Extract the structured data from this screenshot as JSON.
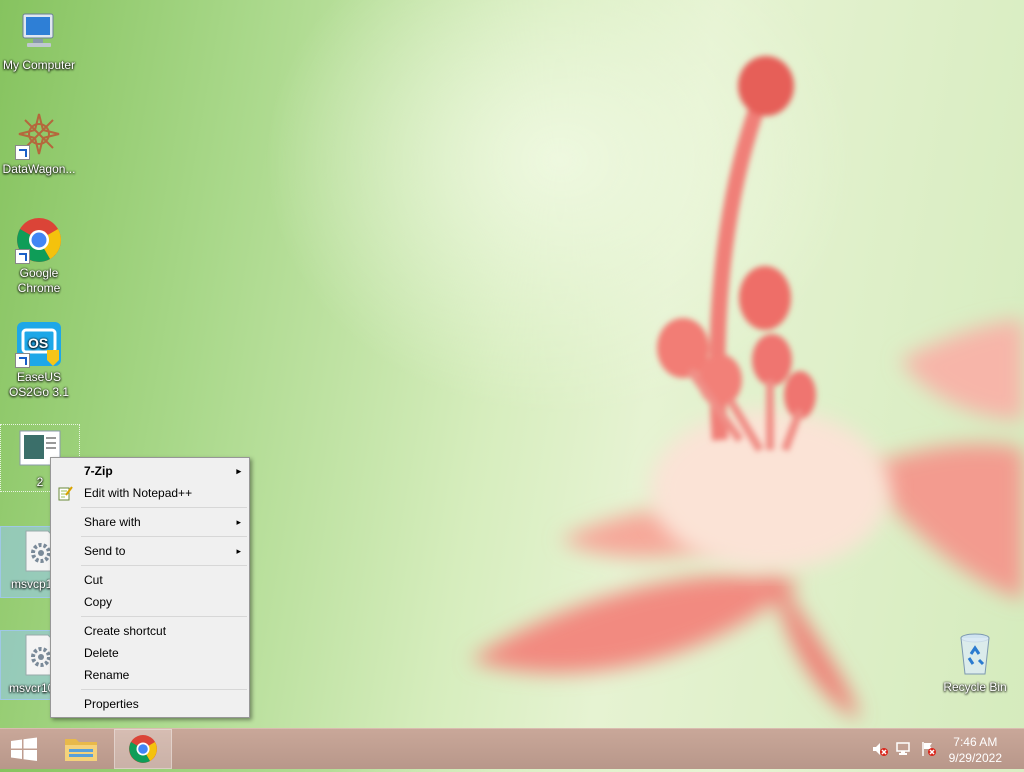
{
  "desktop": {
    "icons": [
      {
        "label": "My Computer"
      },
      {
        "label": "DataWagon..."
      },
      {
        "label": "Google Chrome"
      },
      {
        "label": "EaseUS OS2Go 3.1"
      },
      {
        "label": "2"
      },
      {
        "label": "msvcp10..."
      },
      {
        "label": "msvcr100..."
      },
      {
        "label": "Recycle Bin"
      }
    ]
  },
  "context_menu": {
    "items": [
      {
        "label": "7-Zip",
        "submenu": true
      },
      {
        "label": "Edit with Notepad++"
      },
      {
        "label": "Share with",
        "submenu": true
      },
      {
        "label": "Send to",
        "submenu": true
      },
      {
        "label": "Cut"
      },
      {
        "label": "Copy"
      },
      {
        "label": "Create shortcut"
      },
      {
        "label": "Delete"
      },
      {
        "label": "Rename"
      },
      {
        "label": "Properties"
      }
    ],
    "arrow": "▸"
  },
  "taskbar": {
    "clock": {
      "time": "7:46 AM",
      "date": "9/29/2022"
    }
  },
  "colors": {
    "taskbar": "#c0a092",
    "menu_bg": "#f0f0f0",
    "selection": "#9ac8f0"
  }
}
